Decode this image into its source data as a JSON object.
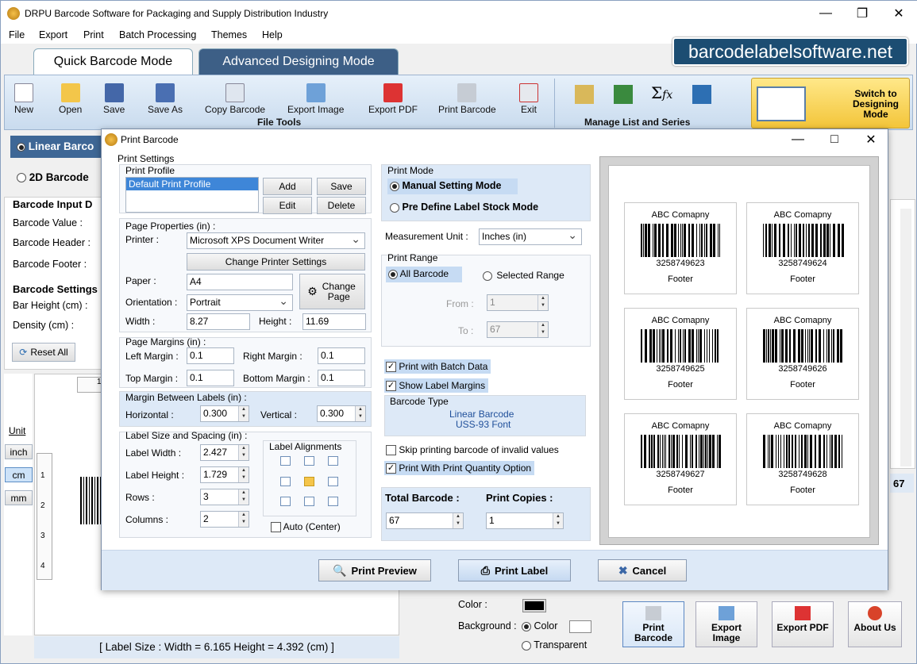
{
  "app": {
    "title": "DRPU Barcode Software for Packaging and Supply Distribution Industry",
    "brand": "barcodelabelsoftware.net"
  },
  "menu": [
    "File",
    "Export",
    "Print",
    "Batch Processing",
    "Themes",
    "Help"
  ],
  "tabs": {
    "quick": "Quick Barcode Mode",
    "advanced": "Advanced Designing Mode"
  },
  "toolbar": {
    "new": "New",
    "open": "Open",
    "save": "Save",
    "save_as": "Save As",
    "copy_barcode": "Copy Barcode",
    "export_image": "Export Image",
    "export_pdf": "Export PDF",
    "print_barcode": "Print Barcode",
    "exit": "Exit",
    "file_tools": "File Tools",
    "manage_list": "Manage List and Series",
    "switch_mode": "Switch to Designing Mode"
  },
  "left": {
    "linear": "Linear Barco",
    "twod": "2D Barcode",
    "input_title": "Barcode Input D",
    "value": "Barcode Value :",
    "header": "Barcode Header :",
    "footer": "Barcode Footer :",
    "settings_title": "Barcode Settings",
    "bar_height": "Bar Height (cm) :",
    "density": "Density (cm) :",
    "reset": "Reset All",
    "unit": "Unit",
    "units": [
      "inch",
      "cm",
      "mm"
    ],
    "ruler_top": "1",
    "ruler_side": [
      "1",
      "2",
      "3",
      "4"
    ],
    "label_size": "[ Label Size : Width = 6.165  Height = 4.392 (cm) ]"
  },
  "right_bg": {
    "color": "Color :",
    "background": "Background :",
    "color_opt": "Color",
    "transparent": "Transparent",
    "count": "67",
    "print_barcode": "Print Barcode",
    "export_image": "Export Image",
    "export_pdf": "Export PDF",
    "about": "About Us"
  },
  "dialog": {
    "title": "Print Barcode",
    "print_settings": "Print Settings",
    "print_profile": "Print Profile",
    "profile_selected": "Default Print Profile",
    "add": "Add",
    "save": "Save",
    "edit": "Edit",
    "delete": "Delete",
    "page_properties": "Page Properties (in) :",
    "printer_label": "Printer :",
    "printer": "Microsoft XPS Document Writer",
    "change_printer": "Change Printer Settings",
    "paper_label": "Paper :",
    "paper": "A4",
    "change_page": "Change Page",
    "orientation_label": "Orientation :",
    "orientation": "Portrait",
    "width_label": "Width :",
    "width": "8.27",
    "height_label": "Height :",
    "height": "11.69",
    "page_margins": "Page Margins (in) :",
    "left_margin_label": "Left Margin :",
    "left_margin": "0.1",
    "right_margin_label": "Right Margin :",
    "right_margin": "0.1",
    "top_margin_label": "Top Margin :",
    "top_margin": "0.1",
    "bottom_margin_label": "Bottom Margin :",
    "bottom_margin": "0.1",
    "margin_between": "Margin Between Labels (in) :",
    "horizontal_label": "Horizontal :",
    "horizontal": "0.300",
    "vertical_label": "Vertical :",
    "vertical": "0.300",
    "label_size_spacing": "Label Size and Spacing (in) :",
    "label_width_label": "Label Width :",
    "label_width": "2.427",
    "label_height_label": "Label Height :",
    "label_height": "1.729",
    "rows_label": "Rows :",
    "rows": "3",
    "columns_label": "Columns :",
    "columns": "2",
    "label_alignments": "Label Alignments",
    "auto_center": "Auto (Center)",
    "print_mode": "Print Mode",
    "manual_mode": "Manual Setting Mode",
    "predefine_mode": "Pre Define Label Stock Mode",
    "measurement_label": "Measurement Unit :",
    "measurement": "Inches (in)",
    "print_range": "Print Range",
    "all_barcode": "All Barcode",
    "selected_range": "Selected Range",
    "from_label": "From :",
    "from": "1",
    "to_label": "To :",
    "to": "67",
    "print_batch": "Print with Batch Data",
    "show_margins": "Show Label Margins",
    "barcode_type": "Barcode Type",
    "type_line1": "Linear Barcode",
    "type_line2": "USS-93 Font",
    "skip_invalid": "Skip printing barcode of invalid values",
    "print_quantity": "Print With Print Quantity Option",
    "total_barcode_label": "Total Barcode :",
    "total_barcode": "67",
    "print_copies_label": "Print Copies :",
    "print_copies": "1",
    "print_preview": "Print Preview",
    "print_label": "Print Label",
    "cancel": "Cancel"
  },
  "preview_labels": [
    {
      "company": "ABC Comapny",
      "number": "3258749623",
      "footer": "Footer"
    },
    {
      "company": "ABC Comapny",
      "number": "3258749624",
      "footer": "Footer"
    },
    {
      "company": "ABC Comapny",
      "number": "3258749625",
      "footer": "Footer"
    },
    {
      "company": "ABC Comapny",
      "number": "3258749626",
      "footer": "Footer"
    },
    {
      "company": "ABC Comapny",
      "number": "3258749627",
      "footer": "Footer"
    },
    {
      "company": "ABC Comapny",
      "number": "3258749628",
      "footer": "Footer"
    }
  ]
}
